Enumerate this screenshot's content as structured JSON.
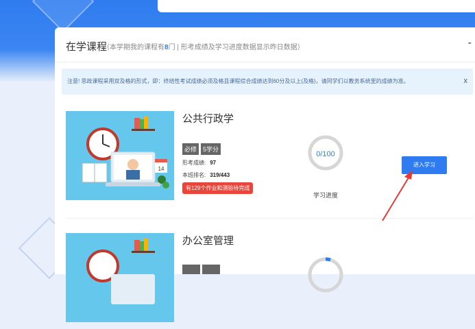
{
  "panel": {
    "title": "在学课程",
    "subtitle_prefix": "（本学期我的课程有",
    "course_count": "8",
    "subtitle_suffix": "门 | 形考成绩及学习进度数据显示昨日数据）",
    "collapse_symbol": "-"
  },
  "notice": {
    "text": "注意! 思政课程采用双及格的形式，即：终结性考试成绩必须及格且课程综合成绩达到60分及以上(及格)，请同学们以教务系统里的成绩为准。",
    "close_symbol": "x"
  },
  "courses": [
    {
      "title": "公共行政学",
      "tag_required": "必修",
      "tag_credits": "5学分",
      "score_label": "形考成绩:",
      "score_value": "97",
      "rank_label": "本班排名:",
      "rank_value": "319/443",
      "pending_text": "有129个作业和测验待完成",
      "progress_text": "0/100",
      "progress_fraction": 0,
      "progress_caption": "学习进度",
      "enter_label": "进入学习",
      "icon_calendar": "14"
    },
    {
      "title": "办公室管理",
      "progress_fraction": 0.05
    }
  ],
  "colors": {
    "accent": "#2f7cf0",
    "warning": "#e8463a",
    "arrow": "#e53935"
  }
}
